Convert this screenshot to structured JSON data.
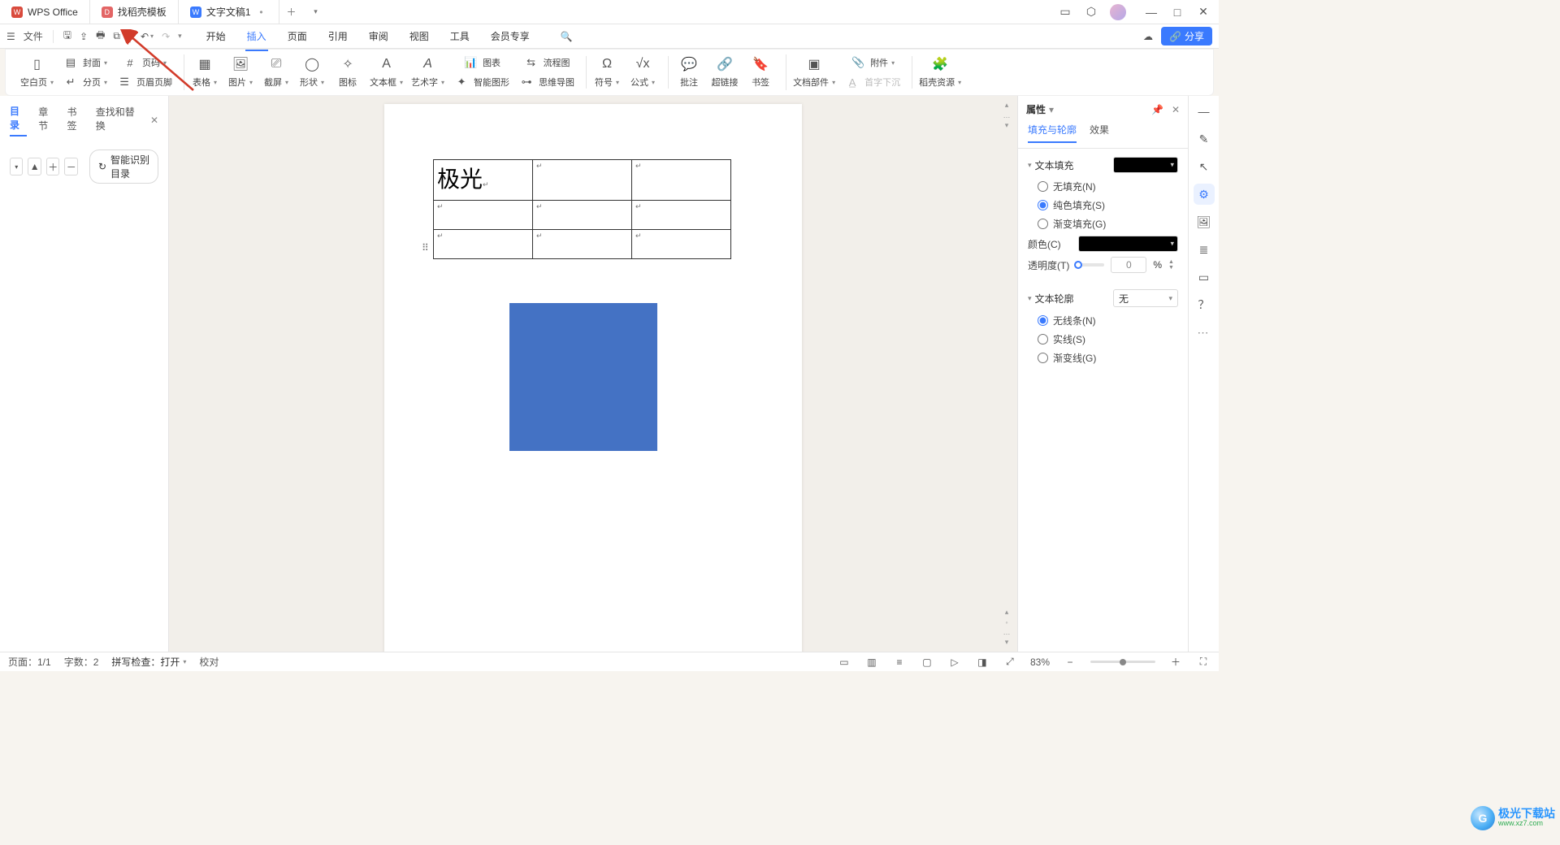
{
  "tabs": {
    "app": {
      "label": "WPS Office",
      "badge": "W"
    },
    "template": {
      "label": "找稻壳模板",
      "badge": "D"
    },
    "doc": {
      "label": "文字文稿1",
      "badge": "W",
      "dirty": "•"
    }
  },
  "quickbar": {
    "file": "文件"
  },
  "menu": {
    "start": "开始",
    "insert": "插入",
    "page": "页面",
    "reference": "引用",
    "review": "审阅",
    "view": "视图",
    "tool": "工具",
    "member": "会员专享"
  },
  "ribbon": {
    "blank": "空白页",
    "cover": "封面",
    "pagebreak": "分页",
    "pagenum": "页码",
    "headerfooter": "页眉页脚",
    "table": "表格",
    "picture": "图片",
    "screenshot": "截屏",
    "shape": "形状",
    "iconlib": "图标",
    "textbox": "文本框",
    "wordart": "艺术字",
    "chart": "图表",
    "smartart": "智能图形",
    "flowchart": "流程图",
    "mindmap": "思维导图",
    "symbol": "符号",
    "equation": "公式",
    "comment": "批注",
    "hyperlink": "超链接",
    "bookmark": "书签",
    "docparts": "文档部件",
    "attachment": "附件",
    "dropcap": "首字下沉",
    "resources": "稻壳资源"
  },
  "share": "分享",
  "leftpanel": {
    "tabs": {
      "toc": "目录",
      "chapter": "章节",
      "bookmark": "书签",
      "findrep": "查找和替换"
    },
    "smart_toc": "智能识别目录"
  },
  "rightpanel": {
    "title": "属性",
    "tabs": {
      "fill": "填充与轮廓",
      "effect": "效果"
    },
    "text_fill": {
      "title": "文本填充",
      "none": "无填充(N)",
      "solid": "纯色填充(S)",
      "gradient": "渐变填充(G)",
      "color_label": "颜色(C)",
      "opacity_label": "透明度(T)",
      "opacity_value": "0",
      "opacity_unit": "%"
    },
    "text_outline": {
      "title": "文本轮廓",
      "select_value": "无",
      "none": "无线条(N)",
      "solid": "实线(S)",
      "gradient": "渐变线(G)"
    }
  },
  "document": {
    "cell_text": "极光"
  },
  "status": {
    "page": "页面：1/1",
    "words": "字数：2",
    "spell": "拼写检查：打开",
    "proof": "校对",
    "zoom": "83%"
  },
  "watermark": {
    "line1": "极光下载站",
    "line2": "www.xz7.com"
  },
  "colors": {
    "accent": "#3a7afe",
    "shape_fill": "#4472c4",
    "swatch": "#000000"
  }
}
